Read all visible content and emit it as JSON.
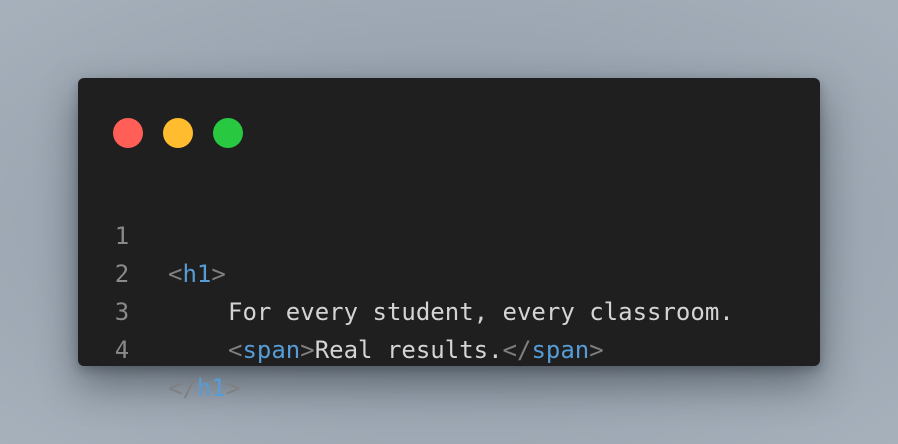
{
  "window": {
    "traffic_lights": [
      {
        "name": "close",
        "color": "#ff5f57"
      },
      {
        "name": "minimize",
        "color": "#febc2e"
      },
      {
        "name": "maximize",
        "color": "#28c840"
      }
    ]
  },
  "code": {
    "colors": {
      "background": "#1f1f1f",
      "punctuation": "#808080",
      "tag": "#569cd6",
      "text": "#d4d4d4",
      "line_number": "#8a8a8a"
    },
    "lines": [
      {
        "number": "1",
        "open": "<",
        "tag": "h1",
        "close": ">"
      },
      {
        "number": "2",
        "text": "For every student, every classroom."
      },
      {
        "number": "3",
        "open1": "<",
        "tag1": "span",
        "close1": ">",
        "text": "Real results.",
        "open2": "</",
        "tag2": "span",
        "close2": ">"
      },
      {
        "number": "4",
        "open": "</",
        "tag": "h1",
        "close": ">"
      }
    ]
  }
}
